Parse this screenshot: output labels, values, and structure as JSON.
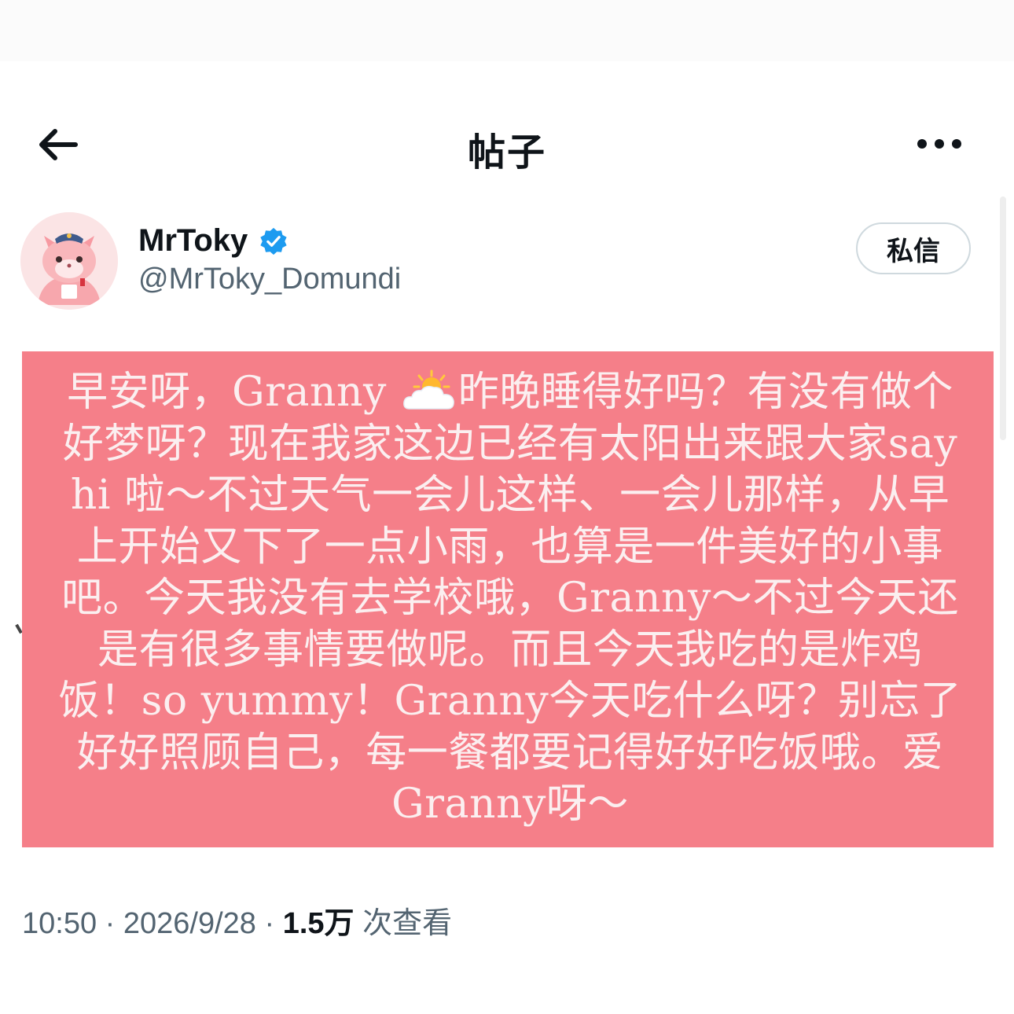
{
  "header": {
    "title": "帖子",
    "back_icon": "arrow-left-icon",
    "more_icon": "more-horizontal-icon"
  },
  "author": {
    "display_name": "MrToky",
    "handle": "@MrToky_Domundi",
    "verified": true,
    "verified_color": "#1d9bf0",
    "dm_label": "私信"
  },
  "post": {
    "background_color": "#f57f89",
    "text_before_icon": "早安呀，Granny ",
    "icon": "sun-behind-cloud-icon",
    "text_after_icon": "昨晚睡得好吗？有没有做个好梦呀？现在我家这边已经有太阳出来跟大家say hi 啦～不过天气一会儿这样、一会儿那样，从早上开始又下了一点小雨，也算是一件美好的小事吧。今天我没有去学校哦，Granny～不过今天还是有很多事情要做呢。而且今天我吃的是炸鸡饭！so yummy！Granny今天吃什么呀？别忘了好好照顾自己，每一餐都要记得好好吃饭哦。爱Granny呀～"
  },
  "meta": {
    "time": "10:50",
    "separator": " · ",
    "date": "2026/9/28",
    "views_count": "1.5万",
    "views_label": " 次查看"
  }
}
